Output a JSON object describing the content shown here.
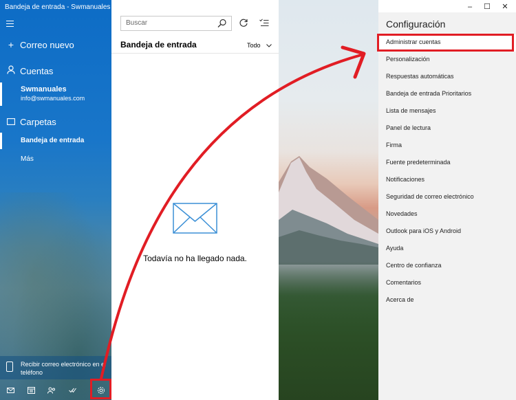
{
  "window": {
    "title": "Bandeja de entrada - Swmanuales",
    "controls": [
      "–",
      "☐",
      "✕"
    ]
  },
  "sidebar": {
    "new_mail": "Correo nuevo",
    "accounts_header": "Cuentas",
    "account": {
      "name": "Swmanuales",
      "email": "info@swmanuales.com"
    },
    "folders_header": "Carpetas",
    "folders": [
      {
        "label": "Bandeja de entrada",
        "selected": true
      },
      {
        "label": "Más",
        "selected": false
      }
    ],
    "phone_promo": "Recibir correo electrónico en el teléfono",
    "bottom_icons": [
      "mail-icon",
      "calendar-icon",
      "people-icon",
      "todo-icon",
      "settings-icon"
    ]
  },
  "message_list": {
    "search_placeholder": "Buscar",
    "folder_title": "Bandeja de entrada",
    "filter_label": "Todo",
    "empty_message": "Todavía no ha llegado nada."
  },
  "settings": {
    "title": "Configuración",
    "items": [
      {
        "label": "Administrar cuentas",
        "highlighted": true
      },
      {
        "label": "Personalización"
      },
      {
        "label": "Respuestas automáticas"
      },
      {
        "label": "Bandeja de entrada Prioritarios"
      },
      {
        "label": "Lista de mensajes"
      },
      {
        "label": "Panel de lectura"
      },
      {
        "label": "Firma"
      },
      {
        "label": "Fuente predeterminada"
      },
      {
        "label": "Notificaciones"
      },
      {
        "label": "Seguridad de correo electrónico"
      },
      {
        "label": "Novedades"
      },
      {
        "label": "Outlook para iOS y Android"
      },
      {
        "label": "Ayuda"
      },
      {
        "label": "Centro de confianza"
      },
      {
        "label": "Comentarios"
      },
      {
        "label": "Acerca de"
      }
    ]
  },
  "colors": {
    "accent": "#0d6cc6",
    "annotation": "#e11d24",
    "settings_bg": "#f2f2f2"
  }
}
